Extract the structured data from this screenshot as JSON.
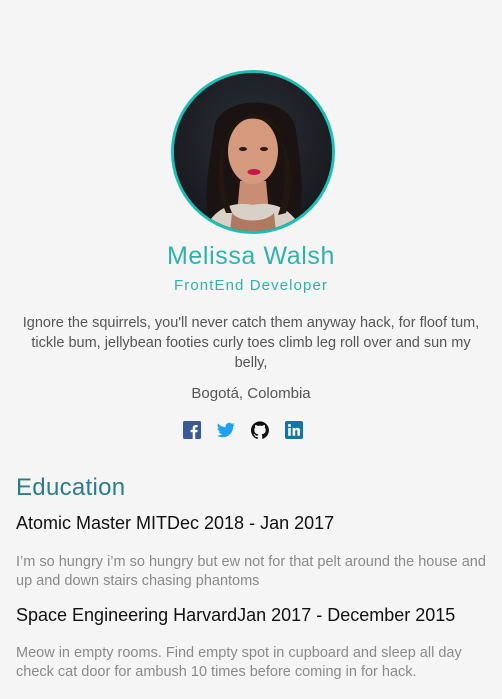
{
  "profile": {
    "name": "Melissa Walsh",
    "role": "FrontEnd Developer",
    "bio": "Ignore the squirrels, you'll never catch them anyway hack, for floof tum, tickle bum, jellybean footies curly toes climb leg roll over and sun my belly,",
    "location": "Bogotá, Colombia",
    "accent_color": "#2fb3a9"
  },
  "social": [
    {
      "icon": "facebook-icon",
      "color": "#3b5998"
    },
    {
      "icon": "twitter-icon",
      "color": "#1da1f2"
    },
    {
      "icon": "github-icon",
      "color": "#111111"
    },
    {
      "icon": "linkedin-icon",
      "color": "#0e76a8"
    }
  ],
  "education": {
    "title": "Education",
    "items": [
      {
        "school": "Atomic Master MIT",
        "dates": "Dec 2018 - Jan 2017",
        "description": "I’m so hungry i’m so hungry but ew not for that pelt around the house and up and down stairs chasing phantoms"
      },
      {
        "school": "Space Engineering Harvard",
        "dates": "Jan 2017 - December 2015",
        "description": "Meow in empty rooms. Find empty spot in cupboard and sleep all day check cat door for ambush 10 times before coming in for hack."
      }
    ]
  }
}
